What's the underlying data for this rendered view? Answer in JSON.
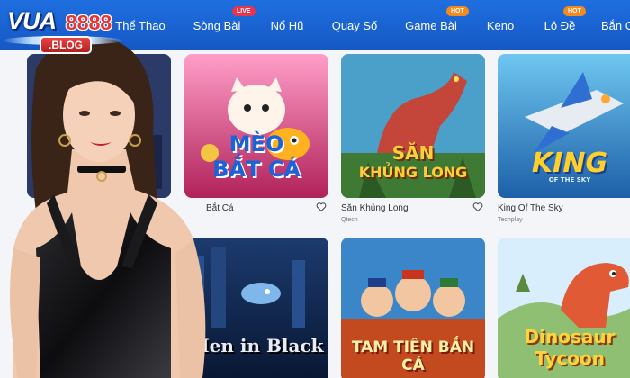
{
  "brand": {
    "logo_text": "VUA",
    "logo_number": "8888",
    "logo_suffix": ".BLOG"
  },
  "nav": {
    "items": [
      {
        "label": "Thể Thao"
      },
      {
        "label": "Sòng Bài",
        "badge": "LIVE"
      },
      {
        "label": "Nổ Hũ"
      },
      {
        "label": "Quay Số"
      },
      {
        "label": "Game Bài",
        "badge": "HOT"
      },
      {
        "label": "Keno"
      },
      {
        "label": "Lô Đề",
        "badge": "HOT"
      },
      {
        "label": "Bắn C"
      }
    ]
  },
  "games": [
    {
      "title": "Bắt Cá",
      "art_text_line1": "MÈO",
      "art_text_line2": "BẮT CÁ"
    },
    {
      "title": "Săn Khủng Long",
      "provider": "Qtech",
      "art_text_line1": "SĂN",
      "art_text_line2": "KHỦNG LONG"
    },
    {
      "title": "King Of The Sky",
      "provider": "Techplay",
      "art_text_line1": "KING",
      "art_text_line2": "OF THE SKY"
    },
    {
      "art_text_line1": "Men in Black"
    },
    {
      "art_text_line1": "TAM TIÊN BẮN CÁ"
    },
    {
      "art_text_line1": "Dinosaur",
      "art_text_line2": "Tycoon"
    }
  ],
  "colors": {
    "nav_bg": "#1f6fe0",
    "badge_live": "#e8344e",
    "badge_hot": "#f38a1d",
    "page_bg": "#f3f5f9"
  },
  "icons": {
    "favorite": "heart-icon"
  }
}
